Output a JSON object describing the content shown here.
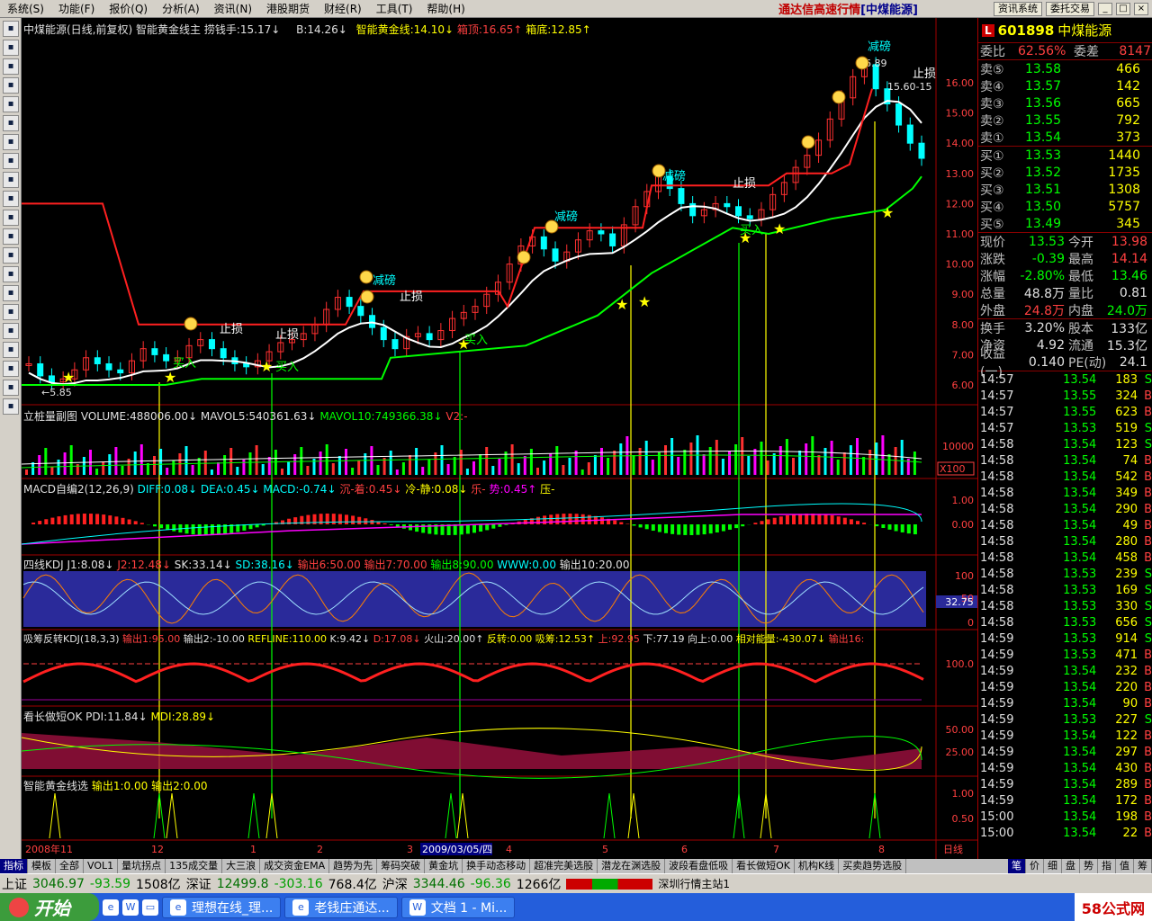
{
  "menu": [
    "系统(S)",
    "功能(F)",
    "报价(Q)",
    "分析(A)",
    "资讯(N)",
    "港股期货",
    "财经(R)",
    "工具(T)",
    "帮助(H)"
  ],
  "app_brand": "通达信高速行情",
  "app_brand_stock": "[中煤能源]",
  "toolbar_buttons": [
    "资讯系统",
    "委托交易"
  ],
  "window_controls": [
    "_",
    "□",
    "×"
  ],
  "left_tools": [
    "grid-icon",
    "bar-icon",
    "line-icon",
    "candle-icon",
    "list-icon",
    "doc-icon",
    "pct-icon",
    "news-icon",
    "people-icon",
    "globe-icon",
    "search-icon",
    "f10-icon",
    "wave-icon",
    "bs-icon",
    "copy-icon",
    "money-icon",
    "pen-icon",
    "gear-icon",
    "move-icon",
    "up-icon",
    "down-icon"
  ],
  "main_panel": {
    "title": "中煤能源(日线,前复权) 智能黄金线主",
    "items": [
      {
        "text": "捞钱手:15.17↓",
        "color": "white"
      },
      {
        "text": "B:14.26↓",
        "color": "yellow"
      },
      {
        "text": "智能黄金线:14.10↓",
        "color": "yellow"
      },
      {
        "text": "箱顶:16.65↑",
        "color": "red"
      },
      {
        "text": "箱底:12.85↑",
        "color": "yellow"
      }
    ],
    "ylabels": [
      "16.00",
      "15.00",
      "14.00",
      "13.00",
      "12.00",
      "11.00",
      "10.00",
      "9.00",
      "8.00",
      "7.00",
      "6.00"
    ],
    "annotations": {
      "low": "←5.85",
      "high": "16.89",
      "range": "15.60-15",
      "stop1": "止损",
      "stop2": "止损",
      "stop3": "止损",
      "stop4": "止损",
      "stop5": "止损",
      "reduce1": "减磅",
      "reduce2": "减磅",
      "reduce3": "减磅",
      "reduce4": "减磅",
      "buy1": "买入",
      "buy2": "买入",
      "buy3": "买入",
      "buy4": "买入"
    }
  },
  "volume_panel": {
    "title": "立桩量副图",
    "items": [
      "VOLUME:488006.00↓",
      "MAVOL5:540361.63↓",
      "MAVOL10:749366.38↓",
      "V2:-"
    ],
    "ylabels": [
      "10000",
      "X100"
    ]
  },
  "macd_panel": {
    "title": "MACD自编2(12,26,9)",
    "items": [
      "DIFF:0.08↓",
      "DEA:0.45↓",
      "MACD:-0.74↓",
      "沉-着:0.45↓",
      "冷-静:0.08↓",
      "乐-",
      "势:0.45↑",
      "压-"
    ],
    "ylabels": [
      "1.00",
      "0.00"
    ]
  },
  "kdj_panel": {
    "title": "四线KDJ",
    "items": [
      "J1:8.08↓",
      "J2:12.48↓",
      "SK:33.14↓",
      "SD:38.16↓",
      "输出6:50.00",
      "输出7:70.00",
      "输出8:90.00",
      "WWW:0.00",
      "输出10:20.00"
    ],
    "ylabels": [
      "100",
      "50",
      "32.75",
      "0"
    ]
  },
  "xichou_panel": {
    "title": "吸筹反转KDJ(18,3,3)",
    "items": [
      "输出1:95.00",
      "输出2:-10.00",
      "REFLINE:110.00",
      "K:9.42↓",
      "D:17.08↓",
      "火山:20.00↑",
      "反转:0.00",
      "吸筹:12.53↑",
      "上:92.95",
      "下:77.19",
      "向上:0.00",
      "相对能量:-430.07↓",
      "输出16:"
    ],
    "ylabels": [
      "100.0"
    ]
  },
  "dmi_panel": {
    "title": "看长做短OK",
    "items": [
      "PDI:11.84↓",
      "MDI:28.89↓"
    ],
    "ylabels": [
      "50.00",
      "25.00"
    ]
  },
  "select_panel": {
    "title": "智能黄金线选",
    "items": [
      "输出1:0.00",
      "输出2:0.00"
    ],
    "ylabels": [
      "1.00",
      "0.50"
    ]
  },
  "xaxis": [
    "2008年11",
    "12",
    "1",
    "2",
    "3",
    "2009/03/05/四",
    "4",
    "5",
    "6",
    "7",
    "8",
    "日线"
  ],
  "quote": {
    "badge": "L",
    "code": "601898",
    "name": "中煤能源",
    "weibi_label": "委比",
    "weibi": "62.56%",
    "weicha_label": "委差",
    "weicha": "8147",
    "sells": [
      {
        "label": "卖⑤",
        "price": "13.58",
        "vol": "466"
      },
      {
        "label": "卖④",
        "price": "13.57",
        "vol": "142"
      },
      {
        "label": "卖③",
        "price": "13.56",
        "vol": "665"
      },
      {
        "label": "卖②",
        "price": "13.55",
        "vol": "792"
      },
      {
        "label": "卖①",
        "price": "13.54",
        "vol": "373"
      }
    ],
    "buys": [
      {
        "label": "买①",
        "price": "13.53",
        "vol": "1440"
      },
      {
        "label": "买②",
        "price": "13.52",
        "vol": "1735"
      },
      {
        "label": "买③",
        "price": "13.51",
        "vol": "1308"
      },
      {
        "label": "买④",
        "price": "13.50",
        "vol": "5757"
      },
      {
        "label": "买⑤",
        "price": "13.49",
        "vol": "345"
      }
    ],
    "stats": [
      {
        "l1": "现价",
        "v1": "13.53",
        "l2": "今开",
        "v2": "13.98"
      },
      {
        "l1": "涨跌",
        "v1": "-0.39",
        "l2": "最高",
        "v2": "14.14"
      },
      {
        "l1": "涨幅",
        "v1": "-2.80%",
        "l2": "最低",
        "v2": "13.46"
      },
      {
        "l1": "总量",
        "v1": "48.8万",
        "l2": "量比",
        "v2": "0.81"
      },
      {
        "l1": "外盘",
        "v1": "24.8万",
        "l2": "内盘",
        "v2": "24.0万"
      }
    ],
    "stats2": [
      {
        "l1": "换手",
        "v1": "3.20%",
        "l2": "股本",
        "v2": "133亿"
      },
      {
        "l1": "净资",
        "v1": "4.92",
        "l2": "流通",
        "v2": "15.3亿"
      },
      {
        "l1": "收益(一)",
        "v1": "0.140",
        "l2": "PE(动)",
        "v2": "24.1"
      }
    ],
    "ticks": [
      [
        "14:57",
        "13.54",
        "183",
        "S"
      ],
      [
        "14:57",
        "13.55",
        "324",
        "B"
      ],
      [
        "14:57",
        "13.55",
        "623",
        "B"
      ],
      [
        "14:57",
        "13.53",
        "519",
        "S"
      ],
      [
        "14:58",
        "13.54",
        "123",
        "S"
      ],
      [
        "14:58",
        "13.54",
        "74",
        "B"
      ],
      [
        "14:58",
        "13.54",
        "542",
        "B"
      ],
      [
        "14:58",
        "13.54",
        "349",
        "B"
      ],
      [
        "14:58",
        "13.54",
        "290",
        "B"
      ],
      [
        "14:58",
        "13.54",
        "49",
        "B"
      ],
      [
        "14:58",
        "13.54",
        "280",
        "B"
      ],
      [
        "14:58",
        "13.54",
        "458",
        "B"
      ],
      [
        "14:58",
        "13.53",
        "239",
        "S"
      ],
      [
        "14:58",
        "13.53",
        "169",
        "S"
      ],
      [
        "14:58",
        "13.53",
        "330",
        "S"
      ],
      [
        "14:58",
        "13.53",
        "656",
        "S"
      ],
      [
        "14:59",
        "13.53",
        "914",
        "S"
      ],
      [
        "14:59",
        "13.53",
        "471",
        "B"
      ],
      [
        "14:59",
        "13.54",
        "232",
        "B"
      ],
      [
        "14:59",
        "13.54",
        "220",
        "B"
      ],
      [
        "14:59",
        "13.54",
        "90",
        "B"
      ],
      [
        "14:59",
        "13.53",
        "227",
        "S"
      ],
      [
        "14:59",
        "13.54",
        "122",
        "B"
      ],
      [
        "14:59",
        "13.54",
        "297",
        "B"
      ],
      [
        "14:59",
        "13.54",
        "430",
        "B"
      ],
      [
        "14:59",
        "13.54",
        "289",
        "B"
      ],
      [
        "14:59",
        "13.54",
        "172",
        "B"
      ],
      [
        "15:00",
        "13.54",
        "198",
        "B"
      ],
      [
        "15:00",
        "13.54",
        "22",
        "B"
      ]
    ]
  },
  "tabs": [
    "指标",
    "模板",
    "全部",
    "VOL1",
    "量坑拐点",
    "135成交量",
    "大三浪",
    "成交资金EMA",
    "趋势为先",
    "筹码突破",
    "黄金坑",
    "换手动态移动",
    "超准完美选股",
    "潜龙在渊选股",
    "波段看盘低吸",
    "看长做短OK",
    "机构K线",
    "买卖趋势选股"
  ],
  "tabs_right": [
    "笔",
    "价",
    "细",
    "盘",
    "势",
    "指",
    "值",
    "筹"
  ],
  "status": {
    "sh_label": "上证",
    "sh_val": "3046.97",
    "sh_chg": "-93.59",
    "sh_amt": "1508亿",
    "sz_label": "深证",
    "sz_val": "12499.8",
    "sz_chg": "-303.16",
    "sz_amt": "768.4亿",
    "hs_label": "沪深",
    "hs_val": "3344.46",
    "hs_chg": "-96.36",
    "hs_amt": "1266亿",
    "server": "深圳行情主站1"
  },
  "taskbar": {
    "start": "开始",
    "tasks": [
      "理想在线_理...",
      "老钱庄通达...",
      "文档 1 - Mi..."
    ],
    "watermark": "58公式网"
  }
}
